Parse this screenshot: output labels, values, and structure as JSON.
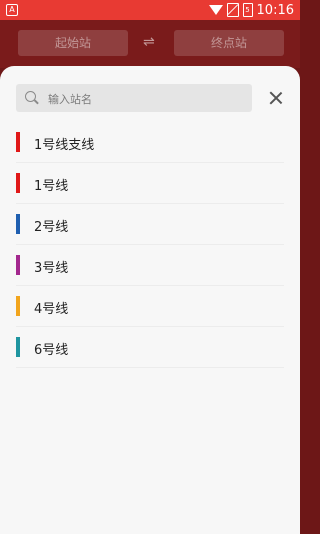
{
  "status_bar": {
    "left_icon": "A",
    "battery_level": "5",
    "time": "10:16"
  },
  "header": {
    "start_station": "起始站",
    "swap_icon": "⇌",
    "end_station": "终点站"
  },
  "sheet": {
    "search": {
      "placeholder": "输入站名",
      "value": ""
    },
    "close_icon": "close-icon",
    "lines": [
      {
        "label": "1号线支线",
        "color": "#e01818"
      },
      {
        "label": "1号线",
        "color": "#e01818"
      },
      {
        "label": "2号线",
        "color": "#1f5fb0"
      },
      {
        "label": "3号线",
        "color": "#a3288e"
      },
      {
        "label": "4号线",
        "color": "#f2a51d"
      },
      {
        "label": "6号线",
        "color": "#1f95a0"
      }
    ]
  }
}
